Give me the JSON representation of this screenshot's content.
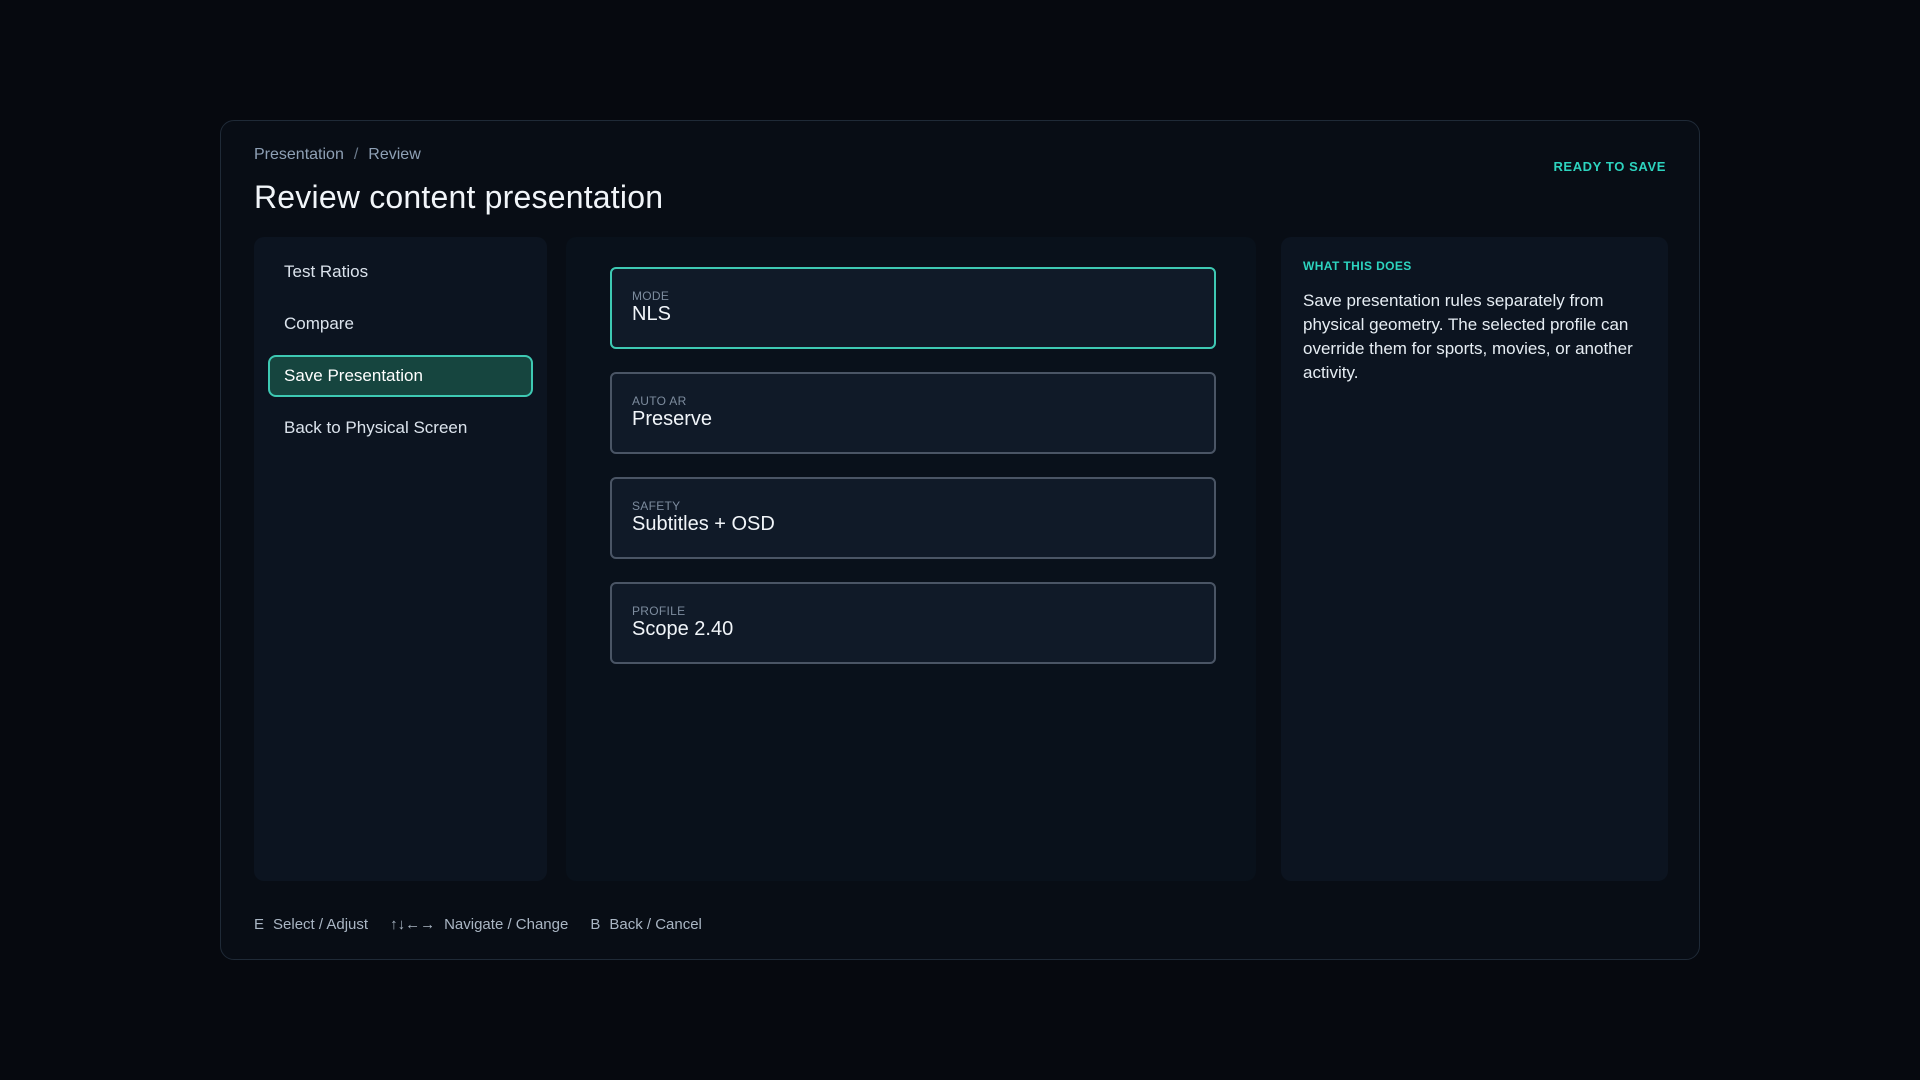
{
  "breadcrumb": {
    "items": [
      "Presentation",
      "Review"
    ],
    "separator": "/"
  },
  "page_title": "Review content presentation",
  "status": {
    "text": "READY TO SAVE",
    "color": "#2dd4bf"
  },
  "sidebar": {
    "items": [
      {
        "label": "Test Ratios",
        "active": false
      },
      {
        "label": "Compare",
        "active": false
      },
      {
        "label": "Save Presentation",
        "active": true
      },
      {
        "label": "Back to Physical Screen",
        "active": false
      }
    ]
  },
  "fields": [
    {
      "label": "MODE",
      "value": "NLS",
      "focused": true
    },
    {
      "label": "AUTO AR",
      "value": "Preserve",
      "focused": false
    },
    {
      "label": "SAFETY",
      "value": "Subtitles + OSD",
      "focused": false
    },
    {
      "label": "PROFILE",
      "value": "Scope 2.40",
      "focused": false
    }
  ],
  "info": {
    "heading": "WHAT THIS DOES",
    "body": "Save presentation rules separately from physical geometry. The selected profile can override them for sports, movies, or another activity."
  },
  "hints": [
    {
      "key": "E",
      "label": "Select / Adjust"
    },
    {
      "key": "↑↓←→",
      "label": "Navigate / Change"
    },
    {
      "key": "B",
      "label": "Back / Cancel"
    }
  ],
  "colors": {
    "accent": "#2dd4bf",
    "active_bg": "#16453f",
    "background": "#06090f"
  }
}
